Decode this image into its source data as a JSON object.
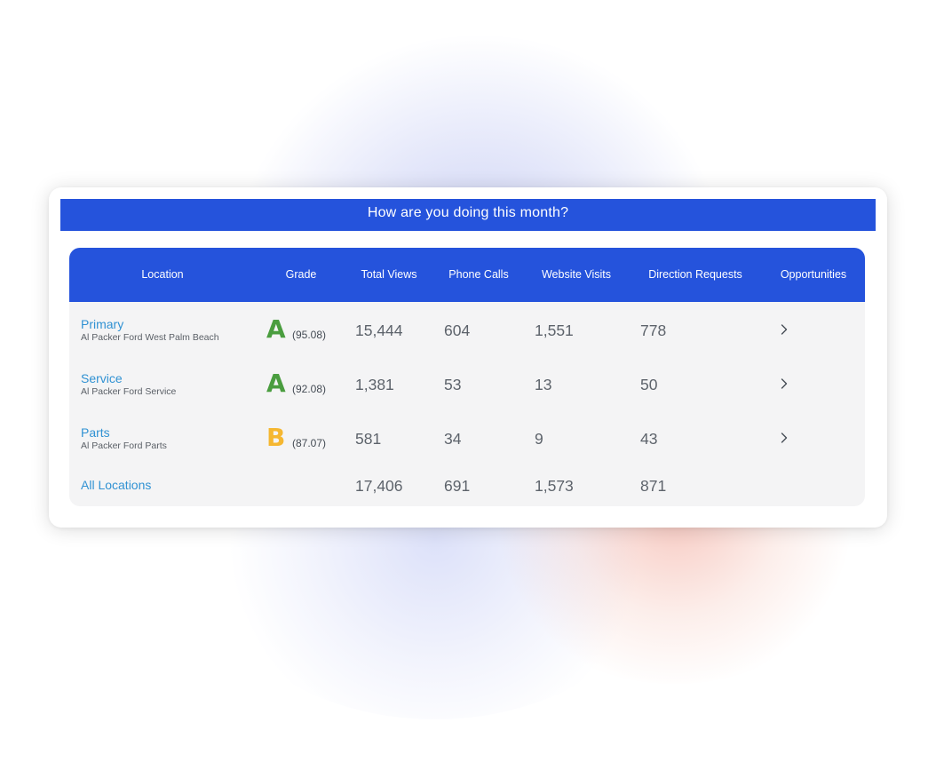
{
  "banner": {
    "title": "How are you doing this month?"
  },
  "table": {
    "headers": [
      "Location",
      "Grade",
      "Total Views",
      "Phone Calls",
      "Website Visits",
      "Direction Requests",
      "Opportunities"
    ],
    "rows": [
      {
        "name": "Primary",
        "subtitle": "Al Packer Ford West Palm Beach",
        "grade": "A",
        "grade_color": "#4a9d3f",
        "score": "(95.08)",
        "total_views": "15,444",
        "phone_calls": "604",
        "website_visits": "1,551",
        "direction_requests": "778",
        "opportunities_icon": "chevron-right-icon"
      },
      {
        "name": "Service",
        "subtitle": "Al Packer Ford Service",
        "grade": "A",
        "grade_color": "#4a9d3f",
        "score": "(92.08)",
        "total_views": "1,381",
        "phone_calls": "53",
        "website_visits": "13",
        "direction_requests": "50",
        "opportunities_icon": "chevron-right-icon"
      },
      {
        "name": "Parts",
        "subtitle": "Al Packer Ford Parts",
        "grade": "B",
        "grade_color": "#f5b731",
        "score": "(87.07)",
        "total_views": "581",
        "phone_calls": "34",
        "website_visits": "9",
        "direction_requests": "43",
        "opportunities_icon": "chevron-right-icon"
      }
    ],
    "totals": {
      "label": "All Locations",
      "total_views": "17,406",
      "phone_calls": "691",
      "website_visits": "1,573",
      "direction_requests": "871"
    }
  },
  "colors": {
    "header_blue": "#2553dc",
    "link_blue": "#3192d3",
    "table_bg": "#f4f4f5"
  }
}
